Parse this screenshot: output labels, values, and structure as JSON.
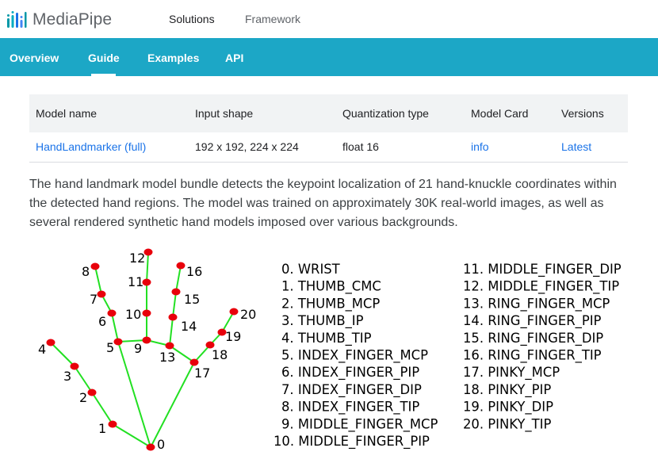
{
  "header": {
    "brand": "MediaPipe",
    "nav": [
      "Solutions",
      "Framework"
    ]
  },
  "tabs": [
    "Overview",
    "Guide",
    "Examples",
    "API"
  ],
  "active_tab": "Guide",
  "model_table": {
    "columns": [
      "Model name",
      "Input shape",
      "Quantization type",
      "Model Card",
      "Versions"
    ],
    "rows": [
      [
        "HandLandmarker (full)",
        "192 x 192, 224 x 224",
        "float 16",
        "info",
        "Latest"
      ]
    ]
  },
  "description": "The hand landmark model bundle detects the keypoint localization of 21 hand-knuckle coordinates within the detected hand regions. The model was trained on approximately 30K real-world images, as well as several rendered synthetic hand models imposed over various backgrounds.",
  "landmarks": [
    "0. WRIST",
    "1. THUMB_CMC",
    "2. THUMB_MCP",
    "3. THUMB_IP",
    "4. THUMB_TIP",
    "5. INDEX_FINGER_MCP",
    "6. INDEX_FINGER_PIP",
    "7. INDEX_FINGER_DIP",
    "8. INDEX_FINGER_TIP",
    "9. MIDDLE_FINGER_MCP",
    "10. MIDDLE_FINGER_PIP",
    "11. MIDDLE_FINGER_DIP",
    "12. MIDDLE_FINGER_TIP",
    "13. RING_FINGER_MCP",
    "14. RING_FINGER_PIP",
    "15. RING_FINGER_DIP",
    "16. RING_FINGER_TIP",
    "17. PINKY_MCP",
    "18. PINKY_PIP",
    "19. PINKY_DIP",
    "20. PINKY_TIP"
  ],
  "point_numbers": [
    "0",
    "1",
    "2",
    "3",
    "4",
    "5",
    "6",
    "7",
    "8",
    "9",
    "10",
    "11",
    "12",
    "13",
    "14",
    "15",
    "16",
    "17",
    "18",
    "19",
    "20"
  ],
  "colors": {
    "tab_bar": "#1ca7c6",
    "link": "#1a73e8",
    "bone": "#22e022",
    "joint": "#e8000b"
  }
}
